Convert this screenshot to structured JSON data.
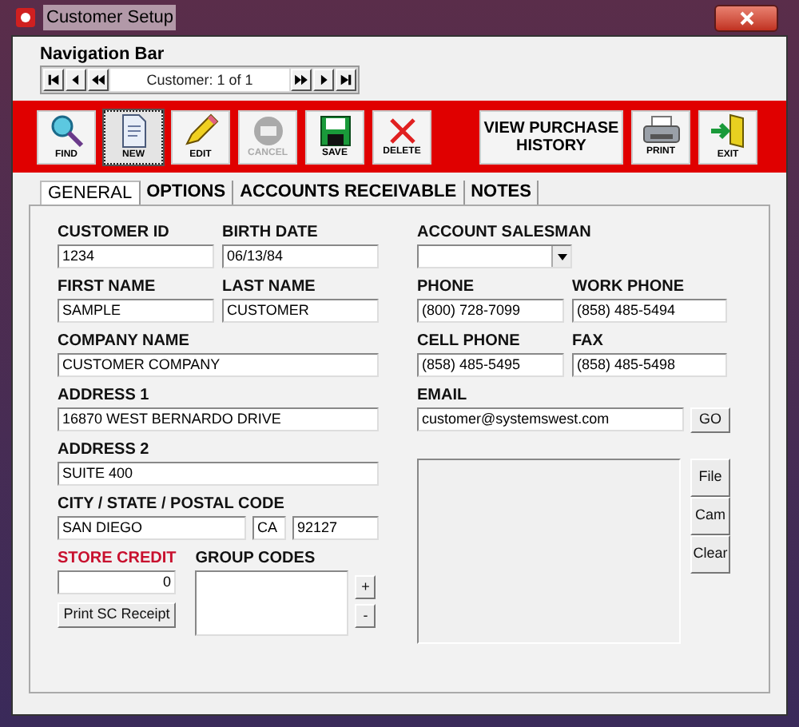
{
  "window": {
    "title": "Customer Setup"
  },
  "navigation_bar": {
    "title": "Navigation Bar",
    "record": "Customer: 1 of 1"
  },
  "toolbar": [
    {
      "kind": "find",
      "label": "FIND",
      "disabled": false,
      "pressed": false
    },
    {
      "kind": "new",
      "label": "NEW",
      "disabled": false,
      "pressed": true
    },
    {
      "kind": "edit",
      "label": "EDIT",
      "disabled": false,
      "pressed": false
    },
    {
      "kind": "cancel",
      "label": "CANCEL",
      "disabled": true,
      "pressed": false
    },
    {
      "kind": "save",
      "label": "SAVE",
      "disabled": false,
      "pressed": false
    },
    {
      "kind": "delete",
      "label": "DELETE",
      "disabled": false,
      "pressed": false
    },
    {
      "kind": "text",
      "label": "VIEW PURCHASE HISTORY",
      "disabled": false,
      "pressed": false
    },
    {
      "kind": "print",
      "label": "PRINT",
      "disabled": false,
      "pressed": false
    },
    {
      "kind": "exit",
      "label": "EXIT",
      "disabled": false,
      "pressed": false
    }
  ],
  "tabs": [
    {
      "label": "GENERAL",
      "selected": true
    },
    {
      "label": "OPTIONS",
      "selected": false
    },
    {
      "label": "ACCOUNTS RECEIVABLE",
      "selected": false
    },
    {
      "label": "NOTES",
      "selected": false
    }
  ],
  "general": {
    "customer_id": {
      "label": "CUSTOMER ID",
      "value": "1234"
    },
    "birth_date": {
      "label": "BIRTH DATE",
      "value": "06/13/84"
    },
    "first_name": {
      "label": "FIRST NAME",
      "value": "SAMPLE"
    },
    "last_name": {
      "label": "LAST NAME",
      "value": "CUSTOMER"
    },
    "company_name": {
      "label": "COMPANY NAME",
      "value": "CUSTOMER COMPANY"
    },
    "address_1": {
      "label": "ADDRESS 1",
      "value": "16870 WEST BERNARDO DRIVE"
    },
    "address_2": {
      "label": "ADDRESS 2",
      "value": "SUITE 400"
    },
    "city_state_postal": {
      "label": "CITY / STATE / POSTAL CODE",
      "city": "SAN DIEGO",
      "state": "CA",
      "postal": "92127"
    },
    "store_credit": {
      "label": "STORE CREDIT",
      "value": "0",
      "button": "Print SC Receipt"
    },
    "group_codes": {
      "label": "GROUP CODES",
      "add": "+",
      "remove": "-"
    },
    "account_salesman": {
      "label": "ACCOUNT SALESMAN"
    },
    "phone": {
      "label": "PHONE",
      "value": "(800) 728-7099"
    },
    "work_phone": {
      "label": "WORK PHONE",
      "value": "(858) 485-5494"
    },
    "cell_phone": {
      "label": "CELL PHONE",
      "value": "(858) 485-5495"
    },
    "fax": {
      "label": "FAX",
      "value": "(858) 485-5498"
    },
    "email": {
      "label": "EMAIL",
      "value": "customer@systemswest.com",
      "button": "GO"
    },
    "photo_buttons": [
      "File",
      "Cam",
      "Clear"
    ]
  }
}
